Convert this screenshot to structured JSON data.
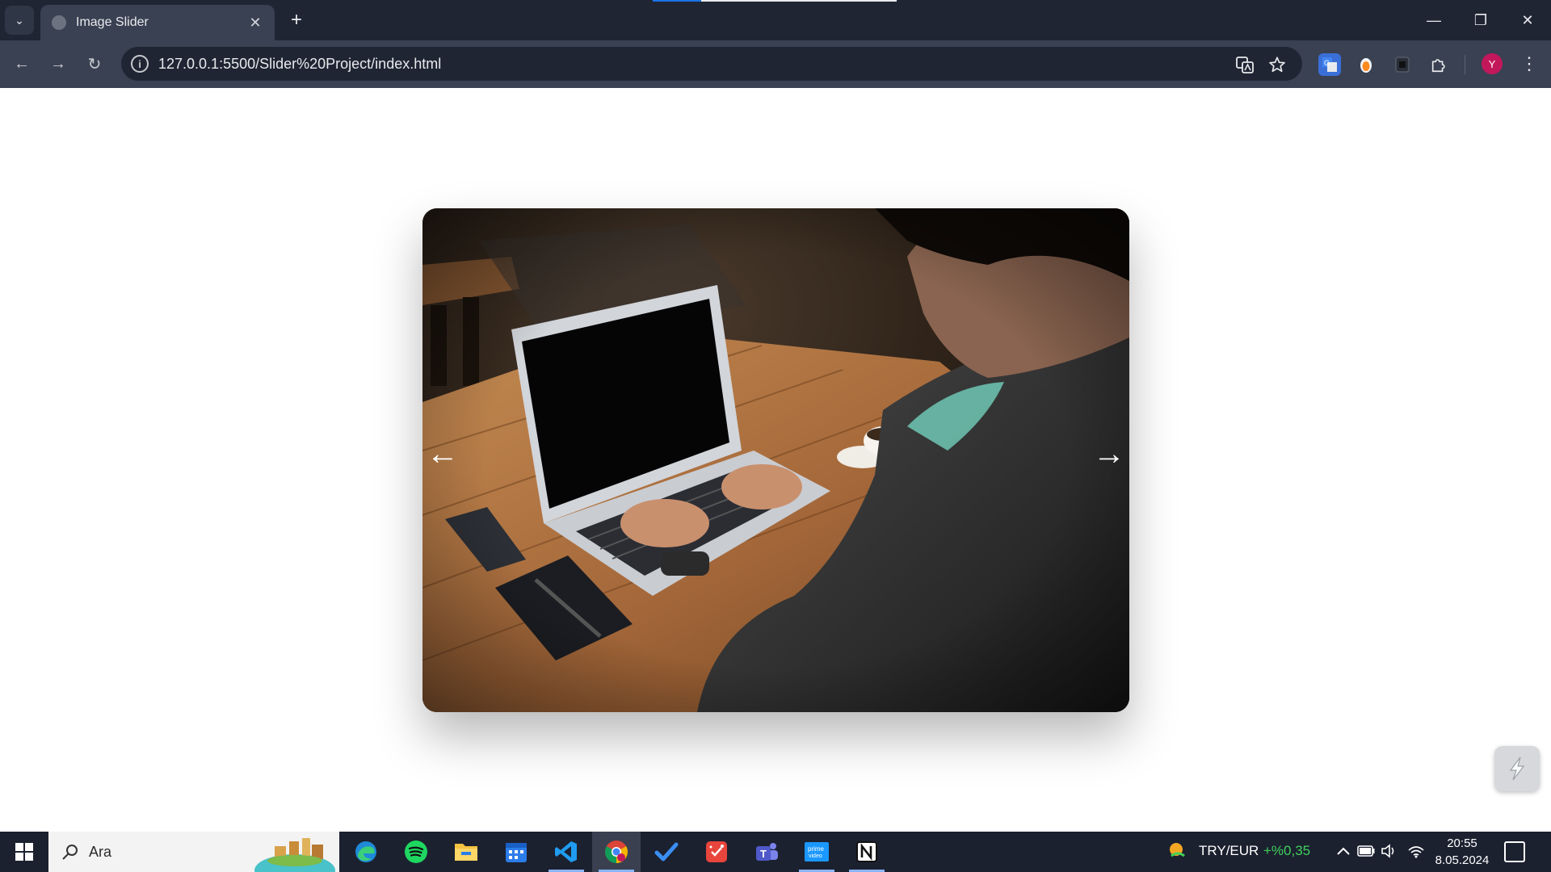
{
  "browser": {
    "tab": {
      "title": "Image Slider",
      "close": "✕"
    },
    "new_tab": "+",
    "window": {
      "minimize": "—",
      "restore": "❐",
      "close": "✕"
    },
    "nav": {
      "back": "←",
      "forward": "→",
      "reload": "↻"
    },
    "url": "127.0.0.1:5500/Slider%20Project/index.html",
    "info": "i",
    "profile_initial": "Y",
    "menu": "⋮"
  },
  "slider": {
    "prev": "←",
    "next": "→"
  },
  "taskbar": {
    "search_text": "Ara",
    "ticker": {
      "pair": "TRY/EUR",
      "change": "+%0,35",
      "change_color": "#3fd15a"
    },
    "time": "20:55",
    "date": "8.05.2024"
  },
  "colors": {
    "chrome_dark": "#1f2533",
    "chrome_mid": "#3a4152",
    "taskbar": "#1c2130"
  }
}
